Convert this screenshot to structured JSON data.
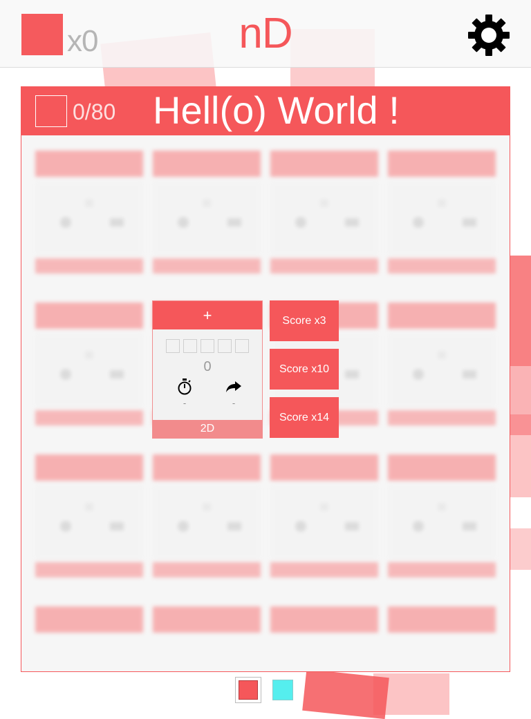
{
  "header": {
    "coin_count": "x0",
    "app_title": "nD",
    "settings_icon": "gear-icon"
  },
  "world": {
    "progress": "0/80",
    "title": "Hell(o) World !"
  },
  "level_card": {
    "open_icon": "+",
    "stars_total": 5,
    "stars_earned": 0,
    "score": "0",
    "timer_icon": "stopwatch-icon",
    "moves_icon": "arrow-forward-icon",
    "time_value": "-",
    "moves_value": "-",
    "dimension_label": "2D"
  },
  "score_buttons": [
    "Score x3",
    "Score x10",
    "Score x14"
  ],
  "colors": {
    "accent": "#f5575a",
    "alternate": "#55eeee"
  }
}
